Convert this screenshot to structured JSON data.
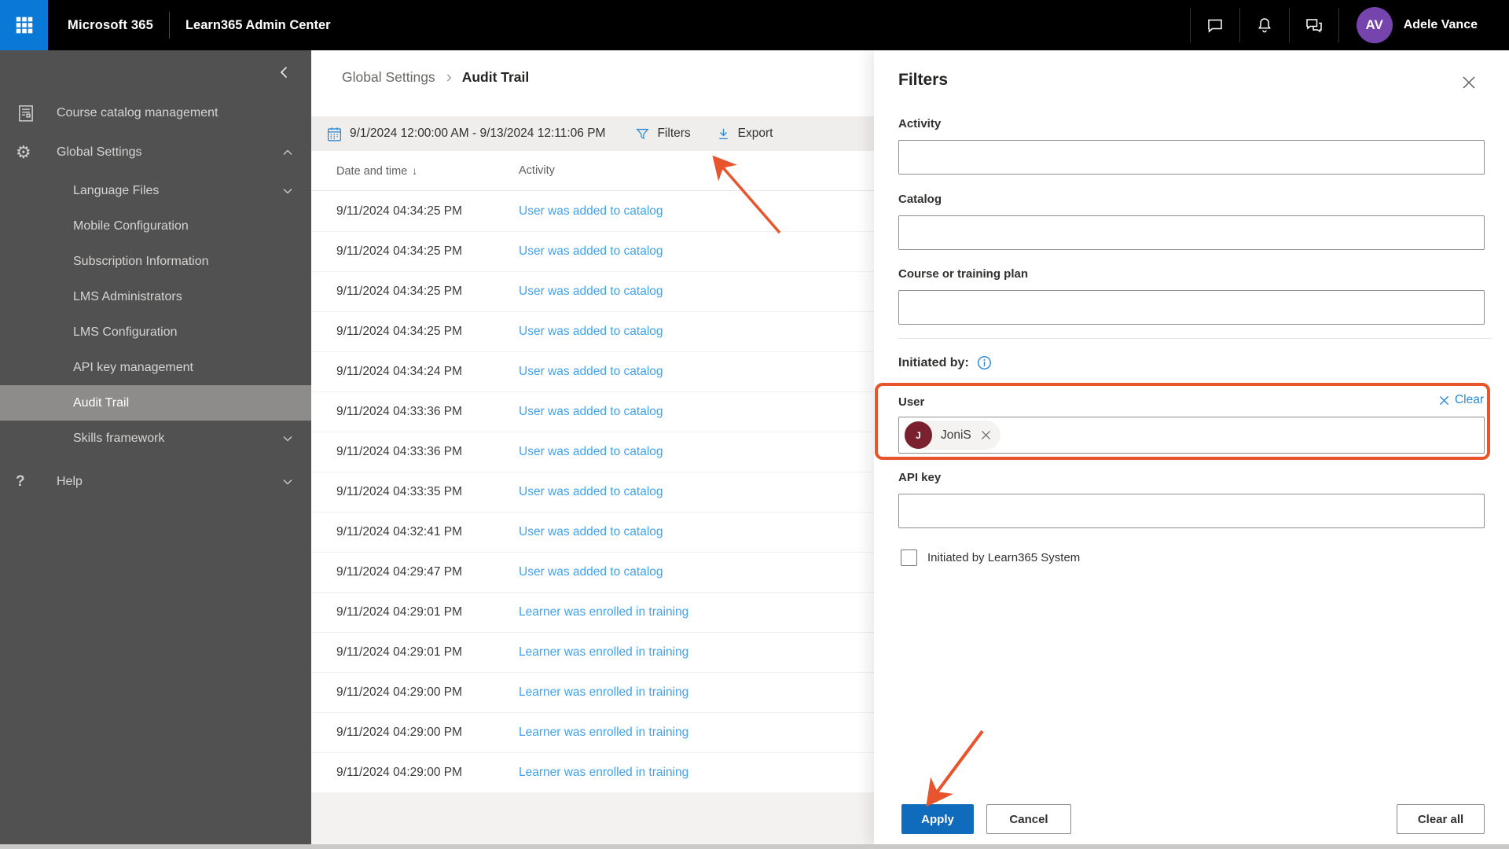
{
  "colors": {
    "accent": "#0f6cbd",
    "annotation": "#e8542c",
    "link_blue": "#2b88d8",
    "activity_link": "#3fa2f1",
    "avatar_purple": "#7644ad",
    "chip_avatar": "#7a202e"
  },
  "topbar": {
    "brand": "Microsoft 365",
    "product": "Learn365 Admin Center",
    "user": {
      "initials": "AV",
      "name": "Adele Vance"
    }
  },
  "sidebar": {
    "items": [
      {
        "label": "Course catalog management"
      },
      {
        "label": "Global Settings"
      },
      {
        "label": "Language Files"
      },
      {
        "label": "Mobile Configuration"
      },
      {
        "label": "Subscription Information"
      },
      {
        "label": "LMS Administrators"
      },
      {
        "label": "LMS Configuration"
      },
      {
        "label": "API key management"
      },
      {
        "label": "Audit Trail"
      },
      {
        "label": "Skills framework"
      },
      {
        "label": "Help"
      }
    ]
  },
  "main": {
    "breadcrumb": {
      "parent": "Global Settings",
      "current": "Audit Trail"
    },
    "toolbar": {
      "date_range": "9/1/2024 12:00:00 AM - 9/13/2024 12:11:06 PM",
      "filters_label": "Filters",
      "export_label": "Export"
    },
    "table": {
      "columns": [
        "Date and time",
        "Activity"
      ],
      "sort_indicator": "↓",
      "rows": [
        {
          "datetime": "9/11/2024 04:34:25 PM",
          "activity": "User was added to catalog"
        },
        {
          "datetime": "9/11/2024 04:34:25 PM",
          "activity": "User was added to catalog"
        },
        {
          "datetime": "9/11/2024 04:34:25 PM",
          "activity": "User was added to catalog"
        },
        {
          "datetime": "9/11/2024 04:34:25 PM",
          "activity": "User was added to catalog"
        },
        {
          "datetime": "9/11/2024 04:34:24 PM",
          "activity": "User was added to catalog"
        },
        {
          "datetime": "9/11/2024 04:33:36 PM",
          "activity": "User was added to catalog"
        },
        {
          "datetime": "9/11/2024 04:33:36 PM",
          "activity": "User was added to catalog"
        },
        {
          "datetime": "9/11/2024 04:33:35 PM",
          "activity": "User was added to catalog"
        },
        {
          "datetime": "9/11/2024 04:32:41 PM",
          "activity": "User was added to catalog"
        },
        {
          "datetime": "9/11/2024 04:29:47 PM",
          "activity": "User was added to catalog"
        },
        {
          "datetime": "9/11/2024 04:29:01 PM",
          "activity": "Learner was enrolled in training"
        },
        {
          "datetime": "9/11/2024 04:29:01 PM",
          "activity": "Learner was enrolled in training"
        },
        {
          "datetime": "9/11/2024 04:29:00 PM",
          "activity": "Learner was enrolled in training"
        },
        {
          "datetime": "9/11/2024 04:29:00 PM",
          "activity": "Learner was enrolled in training"
        },
        {
          "datetime": "9/11/2024 04:29:00 PM",
          "activity": "Learner was enrolled in training"
        }
      ]
    }
  },
  "filters_panel": {
    "title": "Filters",
    "activity_label": "Activity",
    "catalog_label": "Catalog",
    "course_label": "Course or training plan",
    "initiated_by_label": "Initiated by:",
    "user_label": "User",
    "clear_label": "Clear",
    "api_key_label": "API key",
    "checkbox_label": "Initiated by Learn365 System",
    "user_chip": {
      "initial": "J",
      "name": "JoniS"
    },
    "buttons": {
      "apply": "Apply",
      "cancel": "Cancel",
      "clear_all": "Clear all"
    }
  }
}
